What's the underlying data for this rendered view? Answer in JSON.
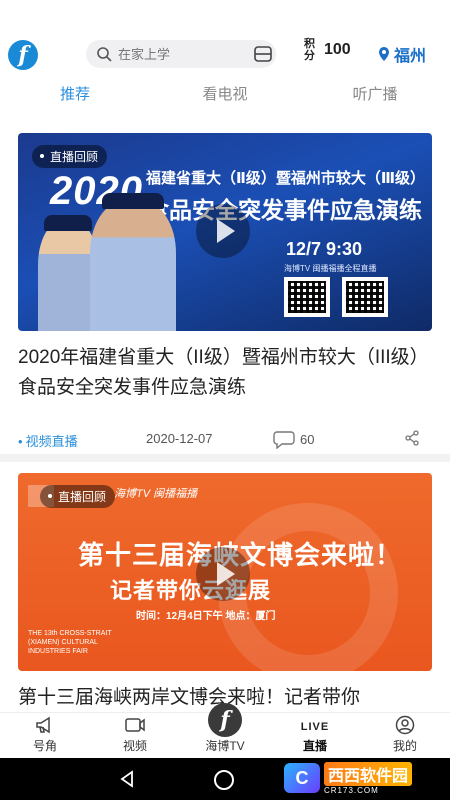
{
  "header": {
    "logo_text": "f",
    "search_placeholder": "在家上学",
    "points_label": "积分",
    "points_value": "100",
    "city": "福州"
  },
  "tabs": [
    {
      "label": "推荐",
      "active": true
    },
    {
      "label": "看电视",
      "active": false
    },
    {
      "label": "听广播",
      "active": false
    }
  ],
  "feed": [
    {
      "badge": "直播回顾",
      "poster": {
        "year": "2020",
        "line1": "福建省重大（Ⅱ级）暨福州市较大（Ⅲ级）",
        "line2": "食品安全突发事件应急演练",
        "time": "12/7   9:30",
        "sub": "海博TV    闽播福播全程直播"
      },
      "title": "2020年福建省重大（II级）暨福州市较大（III级）食品安全突发事件应急演练",
      "category": "视频直播",
      "date": "2020-12-07",
      "comments": "60"
    },
    {
      "badge": "直播回顾",
      "poster": {
        "header": "海博TV   闽播福播",
        "title": "第十三届海峡文博会来啦！",
        "subtitle": "记者带你云逛展",
        "info": "时间：12月4日下午   地点：厦门",
        "english": "THE 13th CROSS-STRAIT (XIAMEN) CULTURAL INDUSTRIES FAIR"
      },
      "title": "第十三届海峡两岸文博会来啦！记者带你"
    }
  ],
  "bottom_nav": [
    {
      "label": "号角",
      "icon": "horn-icon",
      "active": false
    },
    {
      "label": "视频",
      "icon": "video-icon",
      "active": false
    },
    {
      "label": "海博TV",
      "icon": "haibo-logo-icon",
      "active": false
    },
    {
      "label": "直播",
      "icon": "live-icon",
      "mark": "LIVE",
      "active": true
    },
    {
      "label": "我的",
      "icon": "profile-icon",
      "active": false
    }
  ],
  "watermark": {
    "logo": "C",
    "main": "西西软件园",
    "sub": "CR173.COM"
  },
  "colors": {
    "accent": "#2a8fdc",
    "city": "#1a6fc9",
    "poster1": "#1b4fb5",
    "poster2": "#e9571f"
  }
}
